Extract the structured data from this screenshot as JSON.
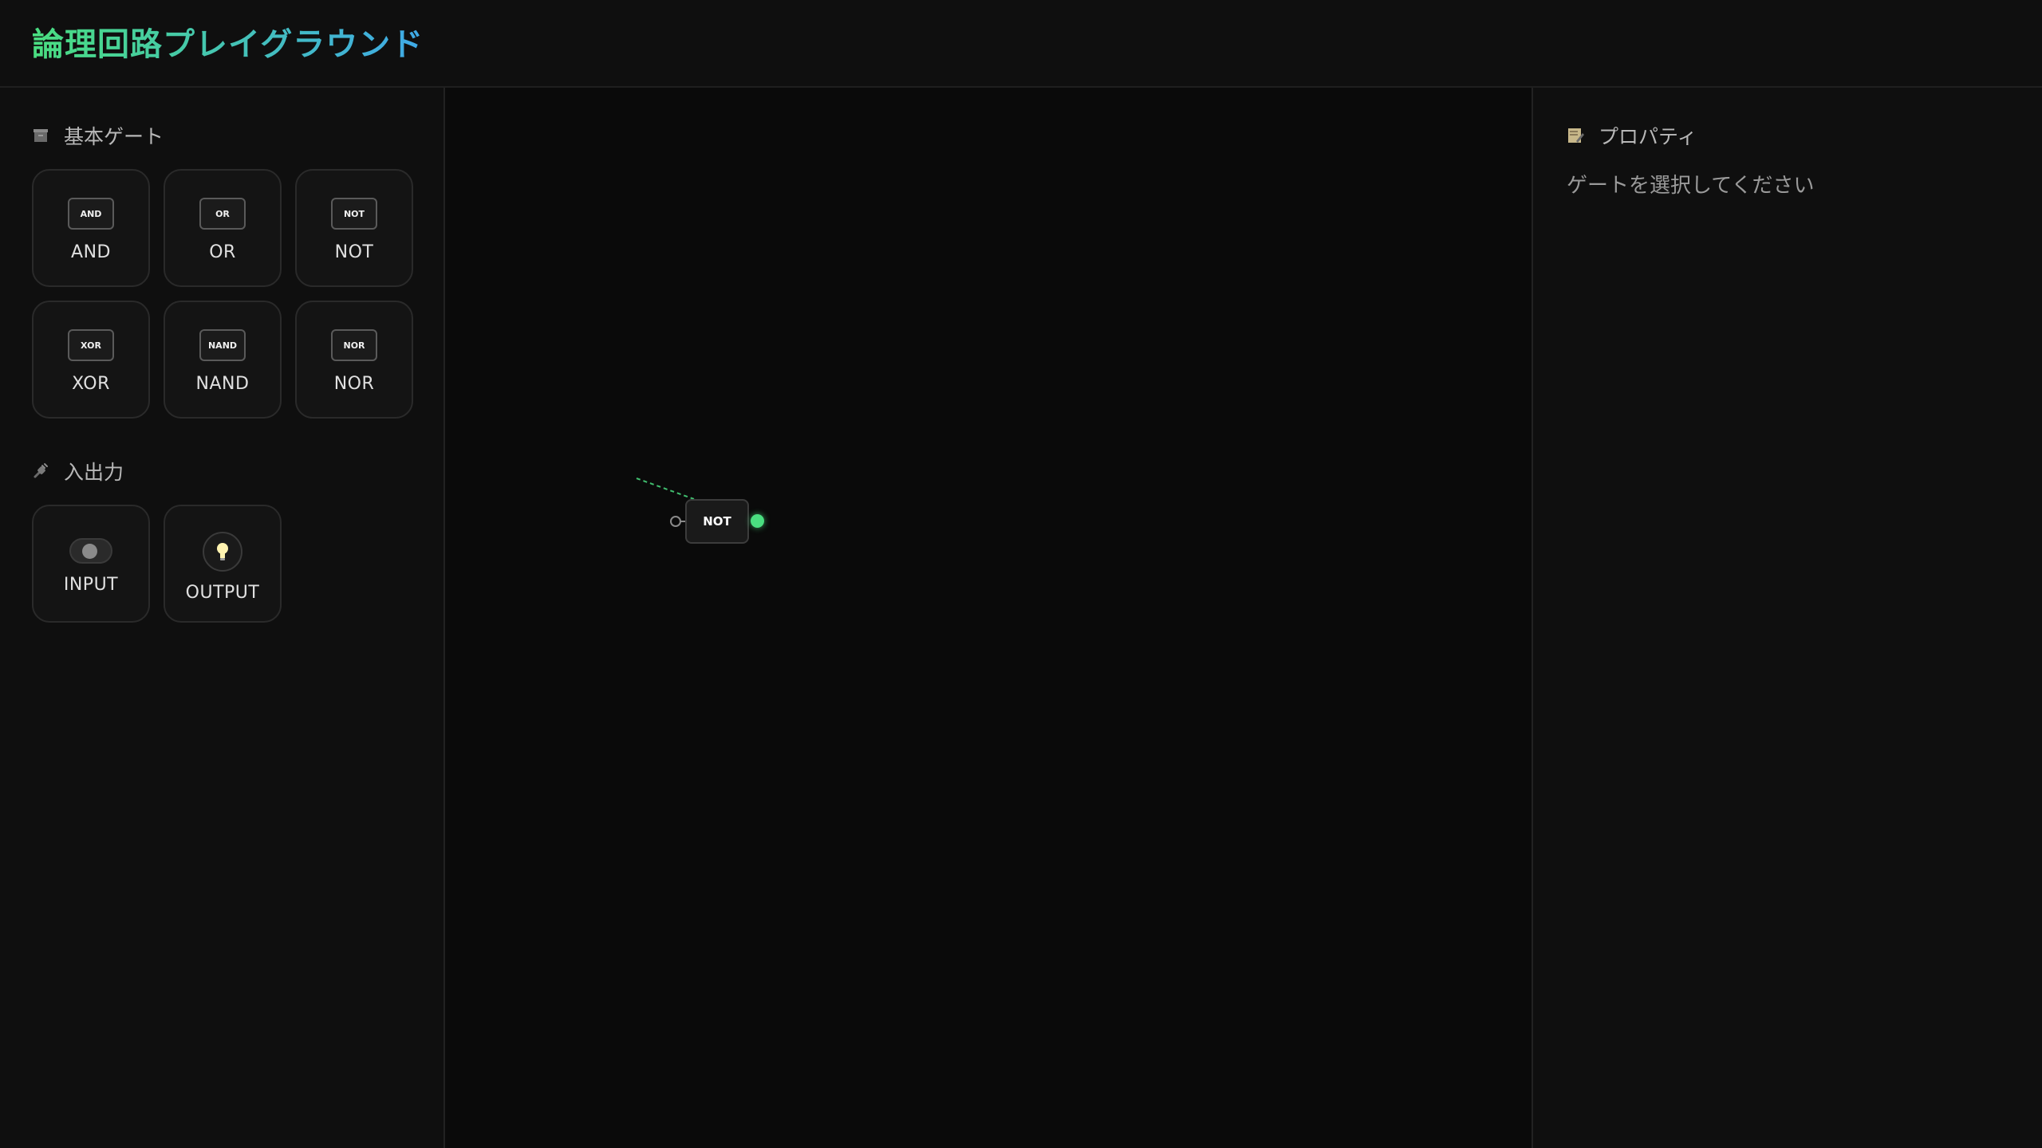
{
  "app": {
    "title": "論理回路プレイグラウンド"
  },
  "sidebar": {
    "basic_gates": {
      "header": "基本ゲート",
      "icon": "box-icon",
      "items": [
        {
          "chip": "AND",
          "label": "AND"
        },
        {
          "chip": "OR",
          "label": "OR"
        },
        {
          "chip": "NOT",
          "label": "NOT"
        },
        {
          "chip": "XOR",
          "label": "XOR"
        },
        {
          "chip": "NAND",
          "label": "NAND"
        },
        {
          "chip": "NOR",
          "label": "NOR"
        }
      ]
    },
    "io": {
      "header": "入出力",
      "icon": "plug-icon",
      "items": [
        {
          "label": "INPUT",
          "icon": "toggle-switch-icon"
        },
        {
          "label": "OUTPUT",
          "icon": "light-bulb-icon"
        }
      ]
    }
  },
  "canvas": {
    "gates": [
      {
        "type": "NOT",
        "label": "NOT",
        "output_active": true
      }
    ]
  },
  "properties": {
    "header": "プロパティ",
    "icon": "memo-icon",
    "empty_text": "ゲートを選択してください"
  },
  "colors": {
    "accent_green": "#4ade80",
    "accent_blue": "#3fa9e8",
    "background": "#0a0a0a",
    "panel": "#0f0f0f"
  }
}
